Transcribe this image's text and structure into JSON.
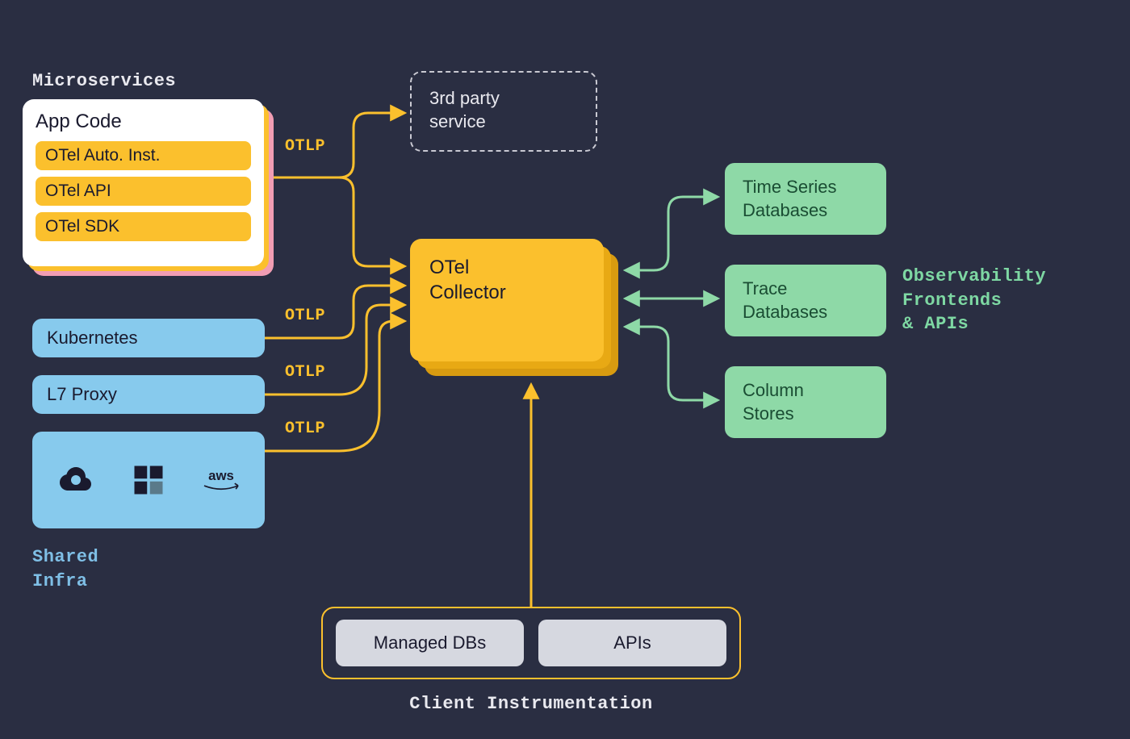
{
  "sections": {
    "microservices_label": "Microservices",
    "shared_infra_label": "Shared\nInfra",
    "observability_label": "Observability\nFrontends\n& APIs",
    "client_instrumentation_label": "Client Instrumentation"
  },
  "microservices": {
    "card_title": "App Code",
    "pills": [
      "OTel Auto. Inst.",
      "OTel API",
      "OTel SDK"
    ]
  },
  "shared_infra": {
    "kubernetes": "Kubernetes",
    "l7_proxy": "L7 Proxy",
    "cloud_providers": [
      "gcp",
      "azure",
      "aws"
    ]
  },
  "third_party": "3rd party\nservice",
  "collector": "OTel\nCollector",
  "databases": {
    "timeseries": "Time Series\nDatabases",
    "trace": "Trace\nDatabases",
    "column": "Column\nStores"
  },
  "client": {
    "managed_dbs": "Managed DBs",
    "apis": "APIs"
  },
  "edge_labels": {
    "otlp1": "OTLP",
    "otlp2": "OTLP",
    "otlp3": "OTLP",
    "otlp4": "OTLP"
  },
  "colors": {
    "bg": "#2a2e42",
    "yellow": "#fbc02d",
    "blue": "#87caed",
    "green": "#8ed9a7",
    "pink": "#f19db3",
    "grey": "#d6d8e0"
  }
}
